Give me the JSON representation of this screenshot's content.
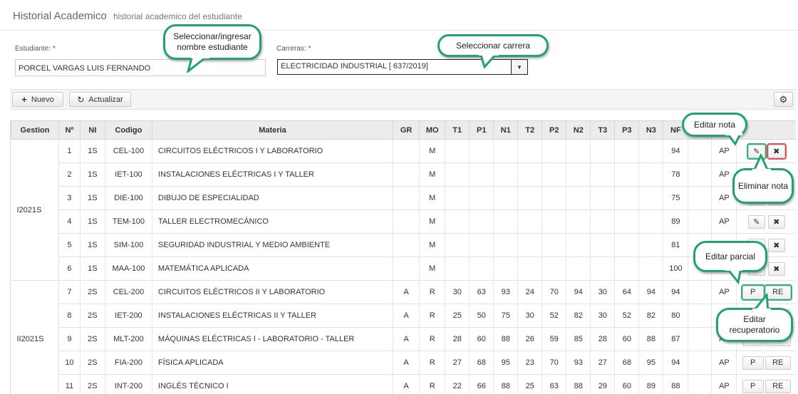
{
  "header": {
    "title": "Historial Academico",
    "subtitle": "historial academico del estudiante"
  },
  "form": {
    "student_label": "Estudiante: *",
    "student_value": "PORCEL VARGAS LUIS FERNANDO",
    "career_label": "Carreras: *",
    "career_value": "ELECTRICIDAD INDUSTRIAL [ 637/2019]"
  },
  "toolbar": {
    "new_label": "Nuevo",
    "refresh_label": "Actualizar",
    "icons": [
      "plus-icon",
      "refresh-icon",
      "gear-icon"
    ]
  },
  "columns": [
    "Gestion",
    "Nº",
    "NI",
    "Codigo",
    "Materia",
    "GR",
    "MO",
    "T1",
    "P1",
    "N1",
    "T2",
    "P2",
    "N2",
    "T3",
    "P3",
    "N3",
    "NF",
    "F",
    "",
    ""
  ],
  "groups": [
    {
      "gestion": "I2021S",
      "rows": [
        {
          "n": "1",
          "ni": "1S",
          "codigo": "CEL-100",
          "materia": "CIRCUITOS ELÉCTRICOS I Y LABORATORIO",
          "gr": "",
          "mo": "M",
          "t1": "",
          "p1": "",
          "n1": "",
          "t2": "",
          "p2": "",
          "n2": "",
          "t3": "",
          "p3": "",
          "n3": "",
          "nf": "94",
          "estado": "AP",
          "actions": "edit-delete"
        },
        {
          "n": "2",
          "ni": "1S",
          "codigo": "IET-100",
          "materia": "INSTALACIONES ELÉCTRICAS I Y TALLER",
          "gr": "",
          "mo": "M",
          "t1": "",
          "p1": "",
          "n1": "",
          "t2": "",
          "p2": "",
          "n2": "",
          "t3": "",
          "p3": "",
          "n3": "",
          "nf": "78",
          "estado": "AP",
          "actions": "edit-delete"
        },
        {
          "n": "3",
          "ni": "1S",
          "codigo": "DIE-100",
          "materia": "DIBUJO DE ESPECIALIDAD",
          "gr": "",
          "mo": "M",
          "t1": "",
          "p1": "",
          "n1": "",
          "t2": "",
          "p2": "",
          "n2": "",
          "t3": "",
          "p3": "",
          "n3": "",
          "nf": "75",
          "estado": "AP",
          "actions": "edit-delete"
        },
        {
          "n": "4",
          "ni": "1S",
          "codigo": "TEM-100",
          "materia": "TALLER ELECTROMECÁNICO",
          "gr": "",
          "mo": "M",
          "t1": "",
          "p1": "",
          "n1": "",
          "t2": "",
          "p2": "",
          "n2": "",
          "t3": "",
          "p3": "",
          "n3": "",
          "nf": "89",
          "estado": "AP",
          "actions": "edit-delete"
        },
        {
          "n": "5",
          "ni": "1S",
          "codigo": "SIM-100",
          "materia": "SEGURIDAD INDUSTRIAL Y MEDIO AMBIENTE",
          "gr": "",
          "mo": "M",
          "t1": "",
          "p1": "",
          "n1": "",
          "t2": "",
          "p2": "",
          "n2": "",
          "t3": "",
          "p3": "",
          "n3": "",
          "nf": "81",
          "estado": "AP",
          "actions": "edit-delete"
        },
        {
          "n": "6",
          "ni": "1S",
          "codigo": "MAA-100",
          "materia": "MATEMÁTICA APLICADA",
          "gr": "",
          "mo": "M",
          "t1": "",
          "p1": "",
          "n1": "",
          "t2": "",
          "p2": "",
          "n2": "",
          "t3": "",
          "p3": "",
          "n3": "",
          "nf": "100",
          "estado": "AP",
          "actions": "edit-delete"
        }
      ]
    },
    {
      "gestion": "II2021S",
      "rows": [
        {
          "n": "7",
          "ni": "2S",
          "codigo": "CEL-200",
          "materia": "CIRCUITOS ELÉCTRICOS II Y LABORATORIO",
          "gr": "A",
          "mo": "R",
          "t1": "30",
          "p1": "63",
          "n1": "93",
          "t2": "24",
          "p2": "70",
          "n2": "94",
          "t3": "30",
          "p3": "64",
          "n3": "94",
          "nf": "94",
          "estado": "AP",
          "actions": "p-re"
        },
        {
          "n": "8",
          "ni": "2S",
          "codigo": "IET-200",
          "materia": "INSTALACIONES ELÉCTRICAS II Y TALLER",
          "gr": "A",
          "mo": "R",
          "t1": "25",
          "p1": "50",
          "n1": "75",
          "t2": "30",
          "p2": "52",
          "n2": "82",
          "t3": "30",
          "p3": "52",
          "n3": "82",
          "nf": "80",
          "estado": "AP",
          "actions": "p-re"
        },
        {
          "n": "9",
          "ni": "2S",
          "codigo": "MLT-200",
          "materia": "MÁQUINAS ELÉCTRICAS I - LABORATORIO - TALLER",
          "gr": "A",
          "mo": "R",
          "t1": "28",
          "p1": "60",
          "n1": "88",
          "t2": "26",
          "p2": "59",
          "n2": "85",
          "t3": "28",
          "p3": "60",
          "n3": "88",
          "nf": "87",
          "estado": "AP",
          "actions": "p-re"
        },
        {
          "n": "10",
          "ni": "2S",
          "codigo": "FIA-200",
          "materia": "FÍSICA APLICADA",
          "gr": "A",
          "mo": "R",
          "t1": "27",
          "p1": "68",
          "n1": "95",
          "t2": "23",
          "p2": "70",
          "n2": "93",
          "t3": "27",
          "p3": "68",
          "n3": "95",
          "nf": "94",
          "estado": "AP",
          "actions": "p-re"
        },
        {
          "n": "11",
          "ni": "2S",
          "codigo": "INT-200",
          "materia": "INGLÉS TÉCNICO I",
          "gr": "A",
          "mo": "R",
          "t1": "22",
          "p1": "66",
          "n1": "88",
          "t2": "25",
          "p2": "63",
          "n2": "88",
          "t3": "29",
          "p3": "60",
          "n3": "89",
          "nf": "88",
          "estado": "AP",
          "actions": "p-re"
        }
      ]
    }
  ],
  "action_labels": {
    "p": "P",
    "re": "RE"
  },
  "callouts": {
    "student": "Seleccionar/ingresar nombre estudiante",
    "career": "Seleccionar carrera",
    "edit_note": "Editar nota",
    "delete_note": "Eliminar nota",
    "edit_partial": "Editar parcial",
    "edit_recovery": "Editar recuperatorio"
  },
  "colors": {
    "callout_border": "#22a07a",
    "highlight_green": "#2db37e",
    "highlight_red": "#e05050"
  }
}
